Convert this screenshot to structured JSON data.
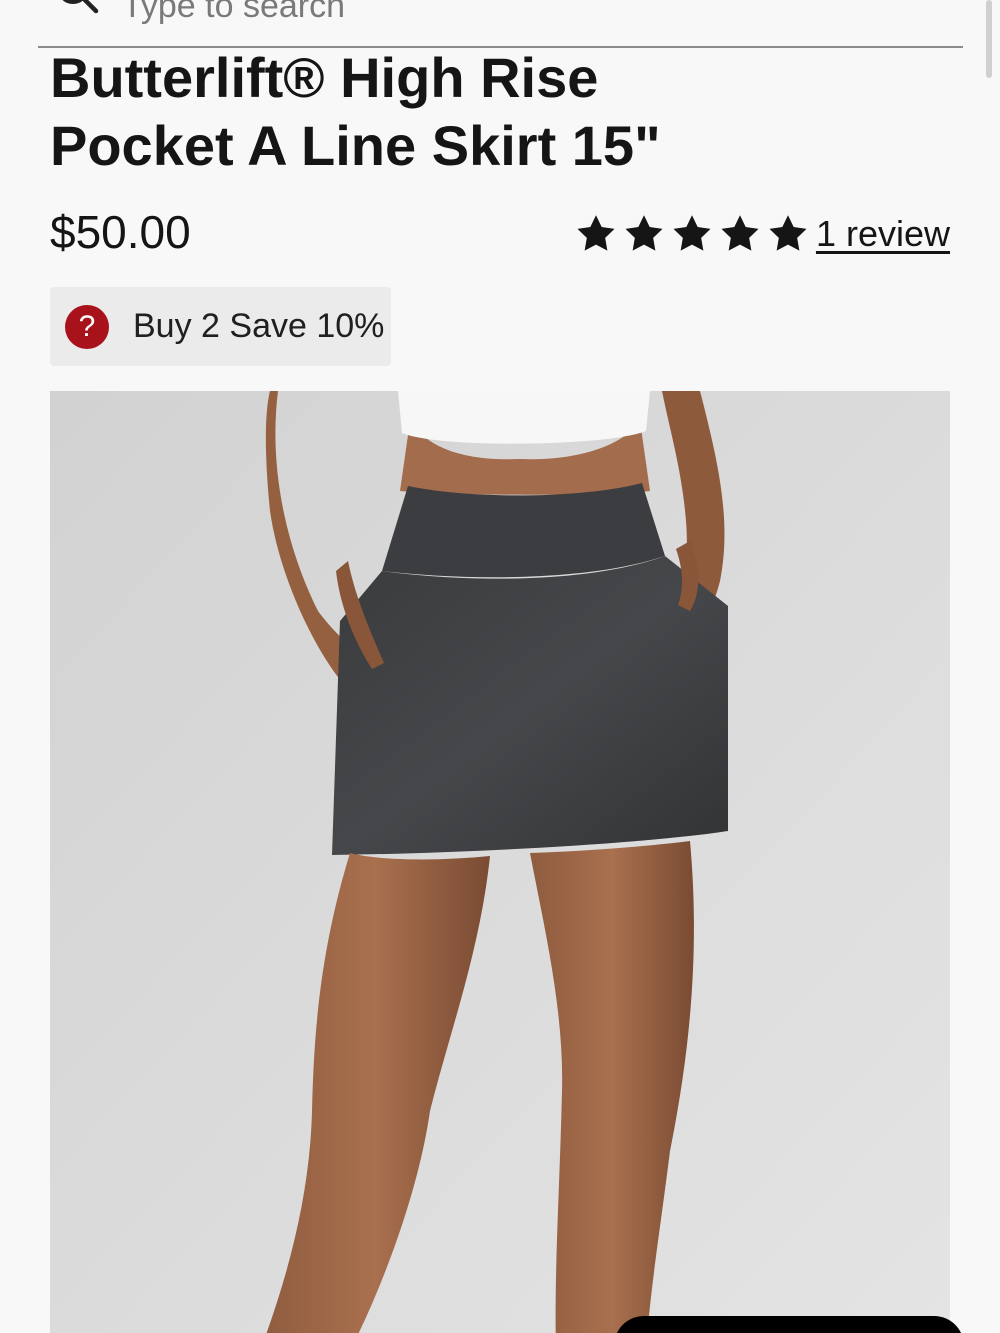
{
  "search": {
    "placeholder": "Type to search"
  },
  "product": {
    "title_line1": "Butterlift® High Rise",
    "title_line2": "Pocket A Line Skirt 15\"",
    "price": "$50.00",
    "rating": {
      "stars": 5,
      "max_stars": 5,
      "review_link": "1 review"
    },
    "promo": {
      "icon_glyph": "?",
      "text": "Buy 2 Save 10%"
    },
    "image": {
      "subject": "woman wearing dark gray high rise A-line skirt with hands in pockets, white crop top"
    }
  },
  "colors": {
    "background": "#f8f8f8",
    "text": "#151515",
    "promo_background": "#ebebeb",
    "promo_icon": "#a8121a",
    "skirt": "#3e3f41"
  }
}
